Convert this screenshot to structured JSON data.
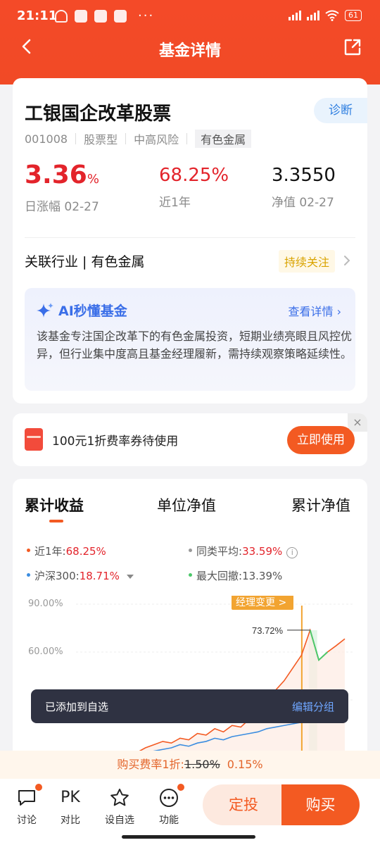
{
  "status_bar": {
    "time": "21:11",
    "battery": "61"
  },
  "nav": {
    "title": "基金详情"
  },
  "fund": {
    "name": "工银国企改革股票",
    "diagnose_label": "诊断",
    "code": "001008",
    "type": "股票型",
    "risk": "中高风险",
    "sector_tag": "有色金属",
    "daily_change": "3.36",
    "daily_change_unit": "%",
    "daily_change_label": "日涨幅 02-27",
    "one_year": "68.25%",
    "one_year_label": "近1年",
    "nav_value": "3.3550",
    "nav_label": "净值 02-27",
    "industry": "关联行业 | 有色金属",
    "follow_label": "持续关注"
  },
  "ai": {
    "title": "AI秒懂基金",
    "more": "查看详情 ›",
    "body": "该基金专注国企改革下的有色金属投资，短期业绩亮眼且风控优异，但行业集中度高且基金经理履新，需持续观察策略延续性。"
  },
  "coupon": {
    "text": "100元1折费率券待使用",
    "button": "立即使用",
    "close": "×"
  },
  "chart_tabs": [
    "累计收益",
    "单位净值",
    "累计净值"
  ],
  "legend": {
    "l1_label": "近1年:",
    "l1_value": "68.25%",
    "l2_label": "同类平均:",
    "l2_value": "33.59%",
    "l3_label": "沪深300:",
    "l3_value": "18.71%",
    "l4_label": "最大回撤:",
    "l4_value": "13.39%"
  },
  "colors": {
    "fund": "#f35a22",
    "avg": "#999999",
    "hs300": "#3b8de0",
    "drawdown": "#4cc86a",
    "accent": "#f35a22"
  },
  "chart_data": {
    "type": "line",
    "yticks": [
      "90.00%",
      "60.00%"
    ],
    "ylim": [
      -10,
      90
    ],
    "annotation": "经理变更 >",
    "peak_label": "73.72%",
    "series": [
      {
        "name": "近1年",
        "values": [
          -12,
          -11,
          -9,
          -10,
          -7,
          -5,
          -8,
          -3,
          0,
          2,
          4,
          3,
          6,
          5,
          9,
          8,
          12,
          10,
          14,
          13,
          18,
          20,
          28,
          36,
          42,
          50,
          58,
          73.72,
          55,
          60,
          64,
          68.25
        ]
      },
      {
        "name": "沪深300",
        "values": [
          -10,
          -9,
          -8,
          -9,
          -7,
          -6,
          -7,
          -5,
          -3,
          -2,
          -1,
          0,
          2,
          1,
          3,
          4,
          6,
          5,
          7,
          8,
          9,
          10,
          12,
          13,
          14,
          15,
          16,
          17,
          16,
          17,
          18,
          18.71
        ]
      }
    ]
  },
  "toast": {
    "text": "已添加到自选",
    "action": "编辑分组"
  },
  "fee": {
    "label": "购买费率1折:",
    "old": "1.50%",
    "new": "0.15%"
  },
  "bottom": {
    "discuss": "讨论",
    "pk": "PK",
    "compare": "对比",
    "watch": "设自选",
    "func": "功能",
    "dingtou": "定投",
    "buy": "购买"
  }
}
